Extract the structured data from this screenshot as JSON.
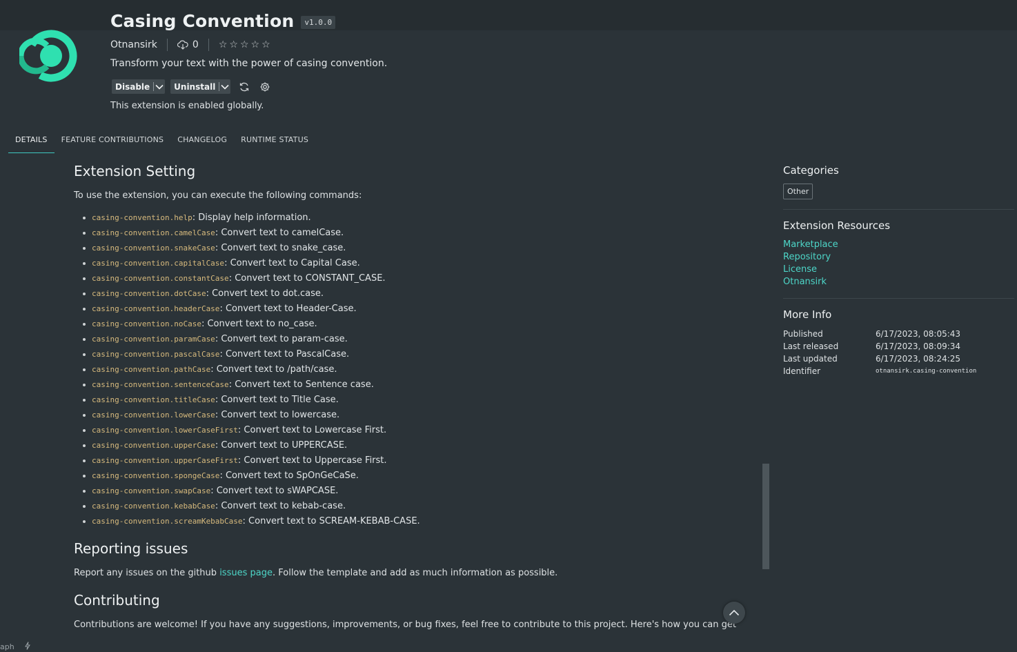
{
  "extension": {
    "name": "Casing Convention",
    "version": "v1.0.0",
    "publisher": "Otnansirk",
    "installs": "0",
    "description": "Transform your text with the power of casing convention.",
    "status_message": "This extension is enabled globally.",
    "actions": {
      "disable": "Disable",
      "uninstall": "Uninstall"
    },
    "brand_color": "#2fe0b0"
  },
  "tabs": [
    "DETAILS",
    "FEATURE CONTRIBUTIONS",
    "CHANGELOG",
    "RUNTIME STATUS"
  ],
  "details": {
    "setting_heading": "Extension Setting",
    "setting_intro": "To use the extension, you can execute the following commands:",
    "commands": [
      {
        "cmd": "casing-convention.help",
        "desc": ": Display help information."
      },
      {
        "cmd": "casing-convention.camelCase",
        "desc": ": Convert text to camelCase."
      },
      {
        "cmd": "casing-convention.snakeCase",
        "desc": ": Convert text to snake_case."
      },
      {
        "cmd": "casing-convention.capitalCase",
        "desc": ": Convert text to Capital Case."
      },
      {
        "cmd": "casing-convention.constantCase",
        "desc": ": Convert text to CONSTANT_CASE."
      },
      {
        "cmd": "casing-convention.dotCase",
        "desc": ": Convert text to dot.case."
      },
      {
        "cmd": "casing-convention.headerCase",
        "desc": ": Convert text to Header-Case."
      },
      {
        "cmd": "casing-convention.noCase",
        "desc": ": Convert text to no_case."
      },
      {
        "cmd": "casing-convention.paramCase",
        "desc": ": Convert text to param-case."
      },
      {
        "cmd": "casing-convention.pascalCase",
        "desc": ": Convert text to PascalCase."
      },
      {
        "cmd": "casing-convention.pathCase",
        "desc": ": Convert text to /path/case."
      },
      {
        "cmd": "casing-convention.sentenceCase",
        "desc": ": Convert text to Sentence case."
      },
      {
        "cmd": "casing-convention.titleCase",
        "desc": ": Convert text to Title Case."
      },
      {
        "cmd": "casing-convention.lowerCase",
        "desc": ": Convert text to lowercase."
      },
      {
        "cmd": "casing-convention.lowerCaseFirst",
        "desc": ": Convert text to Lowercase First."
      },
      {
        "cmd": "casing-convention.upperCase",
        "desc": ": Convert text to UPPERCASE."
      },
      {
        "cmd": "casing-convention.upperCaseFirst",
        "desc": ": Convert text to Uppercase First."
      },
      {
        "cmd": "casing-convention.spongeCase",
        "desc": ": Convert text to SpOnGeCaSe."
      },
      {
        "cmd": "casing-convention.swapCase",
        "desc": ": Convert text to sWAPCASE."
      },
      {
        "cmd": "casing-convention.kebabCase",
        "desc": ": Convert text to kebab-case."
      },
      {
        "cmd": "casing-convention.screamKebabCase",
        "desc": ": Convert text to SCREAM-KEBAB-CASE."
      }
    ],
    "reporting_heading": "Reporting issues",
    "reporting_before": "Report any issues on the github ",
    "reporting_link": "issues page",
    "reporting_after": ". Follow the template and add as much information as possible.",
    "contributing_heading": "Contributing",
    "contributing_text": "Contributions are welcome! If you have any suggestions, improvements, or bug fixes, feel free to contribute to this project. Here's how you can get"
  },
  "sidebar": {
    "categories_heading": "Categories",
    "category": "Other",
    "resources_heading": "Extension Resources",
    "resources": [
      "Marketplace",
      "Repository",
      "License",
      "Otnansirk"
    ],
    "info_heading": "More Info",
    "info": [
      {
        "k": "Published",
        "v": "6/17/2023, 08:05:43"
      },
      {
        "k": "Last released",
        "v": "6/17/2023, 08:09:34"
      },
      {
        "k": "Last updated",
        "v": "6/17/2023, 08:24:25"
      },
      {
        "k": "Identifier",
        "v": "otnansirk.casing-convention"
      }
    ]
  },
  "corner_text": "aph"
}
